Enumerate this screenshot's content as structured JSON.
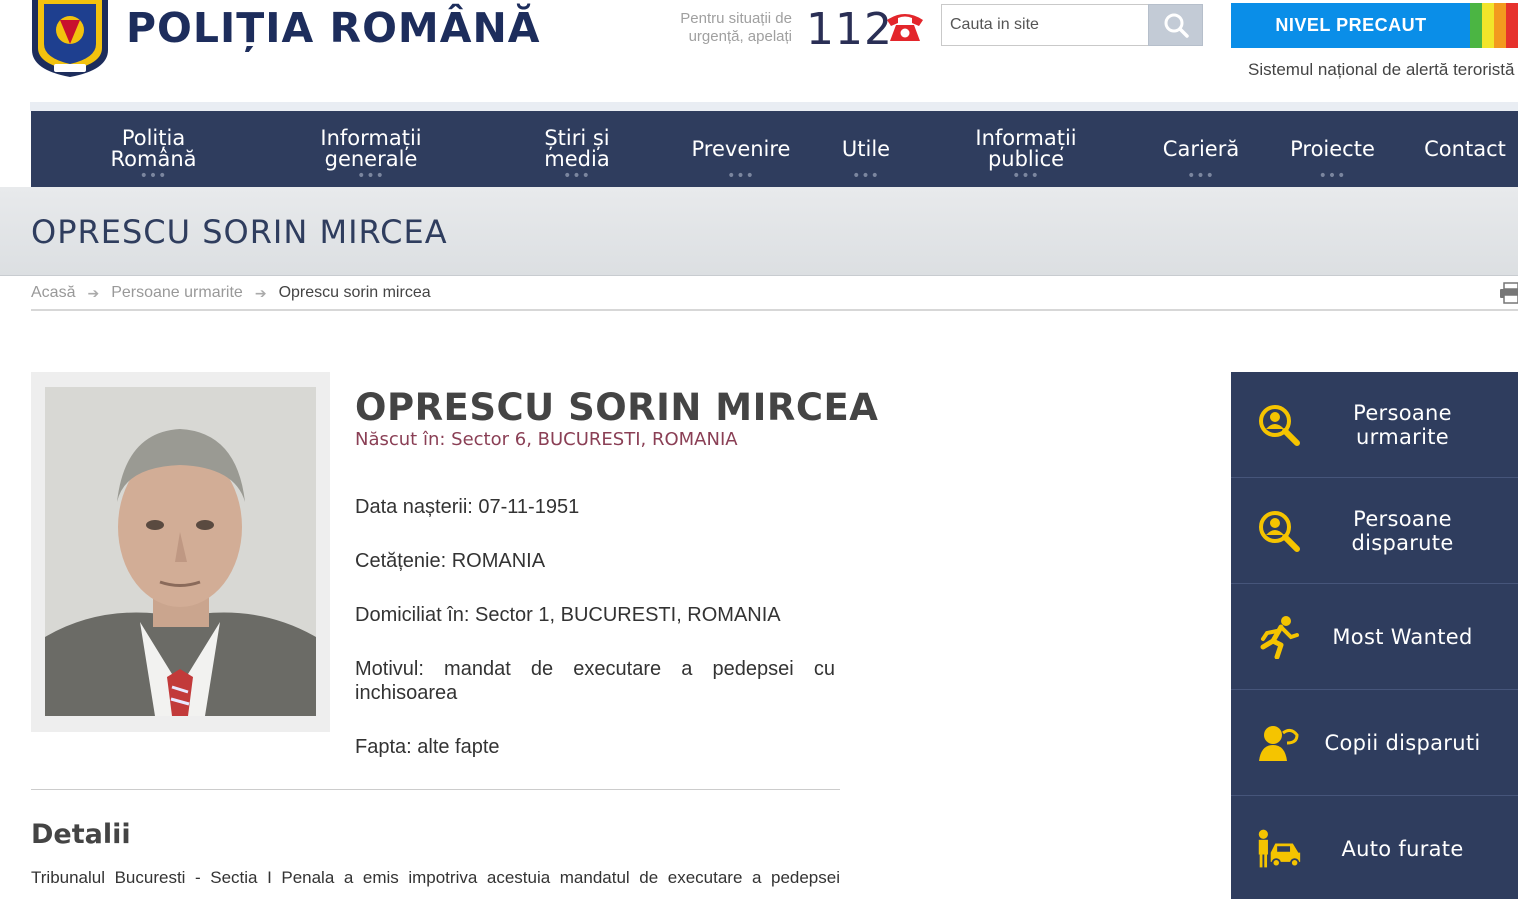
{
  "header": {
    "site_title": "POLIȚIA ROMÂNĂ",
    "emergency_text": "Pentru situații de urgență, apelați",
    "emergency_number": "112",
    "search_placeholder": "Cauta in site",
    "alert_level": "NIVEL PRECAUT",
    "alert_caption": "Sistemul național de alertă teroristă",
    "alert_colors": [
      "#4bb543",
      "#f2e52a",
      "#f39a1e",
      "#e6322d"
    ],
    "brand_color": "#2f3d5e"
  },
  "nav": {
    "items": [
      {
        "label": "Poliția Română"
      },
      {
        "label": "Informații generale"
      },
      {
        "label": "Știri și media"
      },
      {
        "label": "Prevenire"
      },
      {
        "label": "Utile"
      },
      {
        "label": "Informații publice"
      },
      {
        "label": "Carieră"
      },
      {
        "label": "Proiecte"
      },
      {
        "label": "Contact"
      }
    ],
    "dots": "•••"
  },
  "page": {
    "title": "OPRESCU SORIN MIRCEA"
  },
  "breadcrumb": {
    "home": "Acasă",
    "section": "Persoane urmarite",
    "current": "Oprescu sorin mircea",
    "separator": "➔"
  },
  "profile": {
    "name": "OPRESCU SORIN MIRCEA",
    "birthplace": "Născut în: Sector 6, BUCURESTI, ROMANIA",
    "birth_date": "Data nașterii: 07-11-1951",
    "citizenship": "Cetățenie: ROMANIA",
    "domicile": "Domiciliat în: Sector 1, BUCURESTI, ROMANIA",
    "reason": "Motivul: mandat de executare a pedepsei cu inchisoarea",
    "offense": "Fapta: alte fapte"
  },
  "details": {
    "heading": "Detalii",
    "text": "Tribunalul Bucuresti - Sectia I Penala a emis impotriva acestuia mandatul de executare a pedepsei"
  },
  "sidebar": {
    "items": [
      {
        "label": "Persoane urmarite",
        "icon": "magnifier-person-icon"
      },
      {
        "label": "Persoane disparute",
        "icon": "magnifier-person-icon"
      },
      {
        "label": "Most Wanted",
        "icon": "running-person-icon"
      },
      {
        "label": "Copii disparuti",
        "icon": "child-icon"
      },
      {
        "label": "Auto furate",
        "icon": "car-thief-icon"
      }
    ],
    "icon_color": "#f5c400"
  }
}
